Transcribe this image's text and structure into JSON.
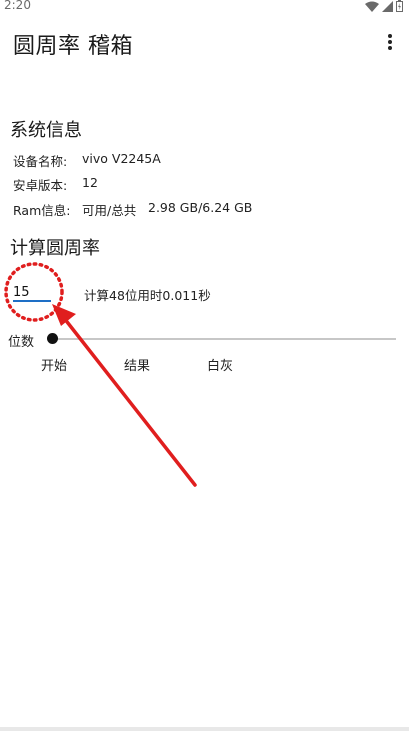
{
  "status_bar": {
    "time": "2:20"
  },
  "app_bar": {
    "title": "圆周率 稽箱",
    "overflow_icon": "more-vert-icon"
  },
  "system_info": {
    "title": "系统信息",
    "device_label": "设备名称:",
    "device_value": "vivo V2245A",
    "android_label": "安卓版本:",
    "android_value": "12",
    "ram_label": "Ram信息:",
    "ram_used_label": "可用/总共",
    "ram_value": "2.98 GB/6.24 GB"
  },
  "calc": {
    "title": "计算圆周率",
    "digits_input_value": "15",
    "result": "计算48位用时0.011秒",
    "slider_label": "位数",
    "slider_value": 0,
    "start_button": "开始",
    "result_button": "结果",
    "white_gray_button": "白灰"
  },
  "annotation": {
    "color": "#e01e1e",
    "shape": "dotted-circle-with-arrow"
  }
}
